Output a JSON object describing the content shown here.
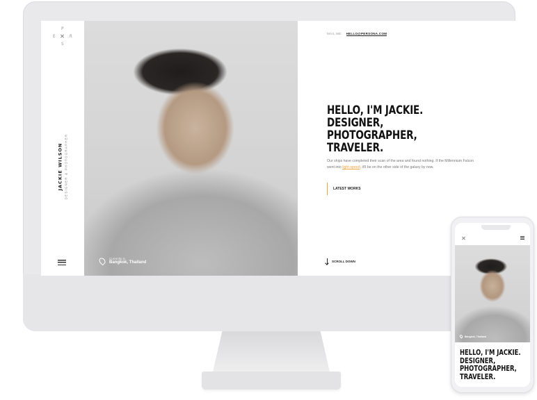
{
  "desktop": {
    "brand": {
      "logo_letters": [
        "P",
        "E",
        "R",
        "S"
      ],
      "name": "JACKIE WILSON",
      "role": "DESIGNER & PHOTOGRAPHER"
    },
    "location": {
      "label": "Currently in",
      "value": "Bangkok, Thailand"
    },
    "mail": {
      "label": "MAIL ME:",
      "address": "HELLO@PERSONA.COM"
    },
    "headline": [
      "HELLO, I'M JACKIE.",
      "DESIGNER, PHOTOGRAPHER,",
      "TRAVELER."
    ],
    "intro": {
      "before": "Our ships have completed their scan of the area and found nothing. If the Millennium Falcon went into ",
      "highlight": "light-speed",
      "after": ", it'll be on the other side of the galaxy by now."
    },
    "latest_works_label": "LATEST WORKS",
    "scroll_label": "SCROLL DOWN"
  },
  "mobile": {
    "location": "Bangkok, Thailand",
    "headline": [
      "HELLO, I'M JACKIE.",
      "DESIGNER,",
      "PHOTOGRAPHER,",
      "TRAVELER."
    ]
  },
  "colors": {
    "accent": "#f0a23d",
    "text": "#111111",
    "device_frame": "#e9e9ec"
  }
}
